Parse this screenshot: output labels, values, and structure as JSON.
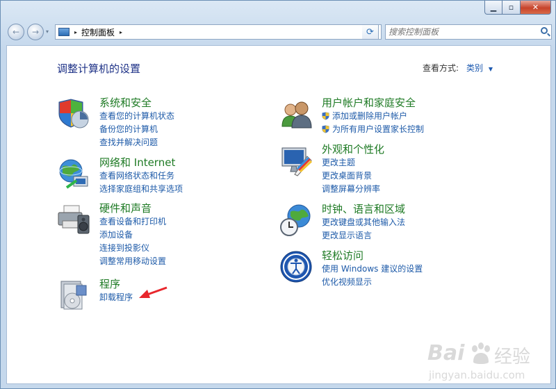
{
  "window": {
    "caption": {
      "minimize": "▁",
      "maximize": "▫",
      "close": "✕"
    }
  },
  "nav": {
    "back_glyph": "←",
    "forward_glyph": "→",
    "recent_glyph": "▾",
    "address": {
      "separator": "▸",
      "crumb": "控制面板",
      "dropdown": "▼"
    },
    "refresh_glyph": "⟳",
    "search_placeholder": "搜索控制面板"
  },
  "main": {
    "heading": "调整计算机的设置",
    "view_by_label": "查看方式:",
    "view_by_value": "类别",
    "view_by_caret": "▼"
  },
  "categories": [
    {
      "title": "系统和安全",
      "icon": "system-security-icon",
      "links": [
        "查看您的计算机状态",
        "备份您的计算机",
        "查找并解决问题"
      ]
    },
    {
      "title": "网络和 Internet",
      "icon": "network-internet-icon",
      "links": [
        "查看网络状态和任务",
        "选择家庭组和共享选项"
      ]
    },
    {
      "title": "硬件和声音",
      "icon": "hardware-sound-icon",
      "links": [
        "查看设备和打印机",
        "添加设备",
        "连接到投影仪",
        "调整常用移动设置"
      ]
    },
    {
      "title": "程序",
      "icon": "programs-icon",
      "links": [
        "卸载程序"
      ]
    },
    {
      "title": "用户帐户和家庭安全",
      "icon": "user-accounts-icon",
      "links": [
        "添加或删除用户帐户",
        "为所有用户设置家长控制"
      ]
    },
    {
      "title": "外观和个性化",
      "icon": "appearance-icon",
      "links": [
        "更改主题",
        "更改桌面背景",
        "调整屏幕分辨率"
      ]
    },
    {
      "title": "时钟、语言和区域",
      "icon": "clock-language-region-icon",
      "links": [
        "更改键盘或其他输入法",
        "更改显示语言"
      ]
    },
    {
      "title": "轻松访问",
      "icon": "ease-of-access-icon",
      "links": [
        "使用 Windows 建议的设置",
        "优化视频显示"
      ]
    }
  ],
  "watermark": {
    "brand": "Bai",
    "brand_suffix": "经验",
    "url": "jingyan.baidu.com"
  },
  "colors": {
    "link": "#1d5aa8",
    "category_title": "#1e7a24",
    "heading": "#1e3287",
    "annotation_arrow": "#e8262c"
  }
}
